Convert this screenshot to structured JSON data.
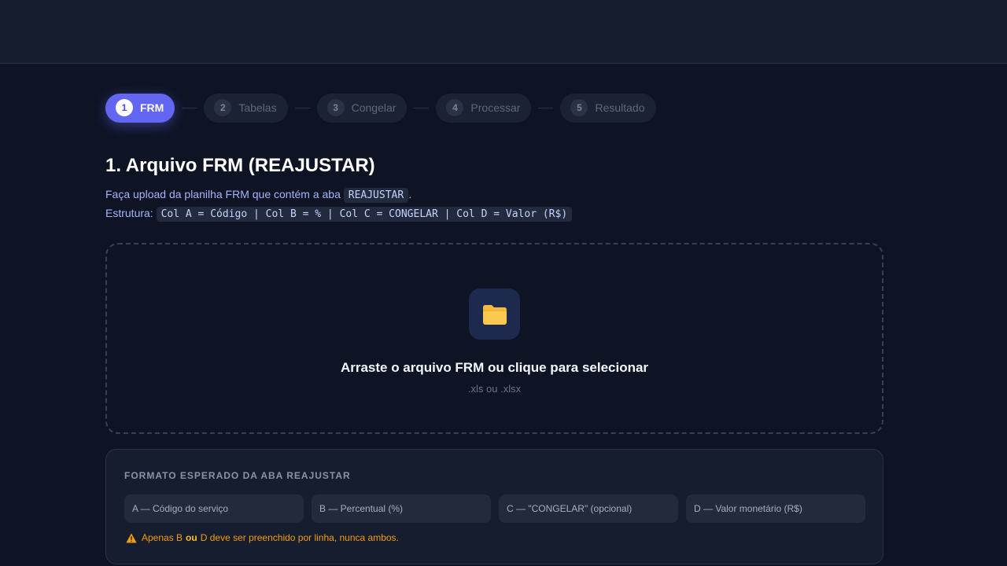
{
  "stepper": {
    "steps": [
      {
        "num": "1",
        "label": "FRM"
      },
      {
        "num": "2",
        "label": "Tabelas"
      },
      {
        "num": "3",
        "label": "Congelar"
      },
      {
        "num": "4",
        "label": "Processar"
      },
      {
        "num": "5",
        "label": "Resultado"
      }
    ],
    "active_step": 1
  },
  "page": {
    "title": "1. Arquivo FRM (REAJUSTAR)",
    "desc_line1_prefix": "Faça upload da planilha FRM que contém a aba",
    "desc_line1_code": "REAJUSTAR",
    "desc_line1_suffix": ".",
    "desc_line2_prefix": "Estrutura:",
    "desc_line2_code": "Col A = Código | Col B = % | Col C = CONGELAR | Col D = Valor (R$)"
  },
  "dropzone": {
    "icon": "folder-icon",
    "title": "Arraste o arquivo FRM ou clique para selecionar",
    "subtitle": ".xls ou .xlsx"
  },
  "format": {
    "title": "FORMATO ESPERADO DA ABA REAJUSTAR",
    "columns": [
      "A — Código do serviço",
      "B — Percentual (%)",
      "C — \"CONGELAR\" (opcional)",
      "D — Valor monetário (R$)"
    ],
    "warning_prefix": "Apenas B",
    "warning_emph": "ou",
    "warning_suffix": "D deve ser preenchido por linha, nunca ambos.",
    "warning_icon": "warning-icon"
  },
  "colors": {
    "accent": "#6366f1",
    "warning": "#f59e0b",
    "background": "#0e1424"
  }
}
